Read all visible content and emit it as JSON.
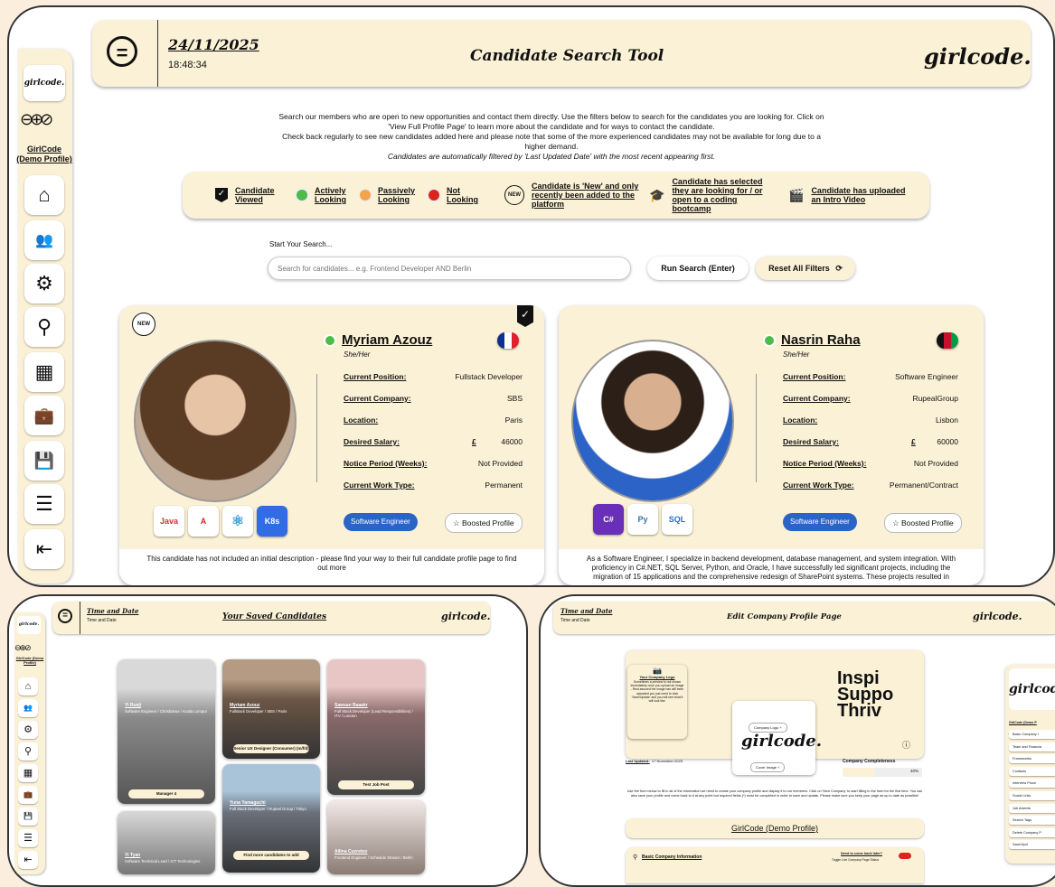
{
  "header": {
    "date": "24/11/2025",
    "time": "18:48:34",
    "title": "Candidate Search Tool",
    "brand": "girlcode."
  },
  "sidebar": {
    "logo": "girlcode.",
    "profile_label": "GirlCode (Demo Profile)",
    "items": [
      {
        "icon": "home-icon",
        "glyph": "⌂"
      },
      {
        "icon": "add-user-icon",
        "glyph": "👥"
      },
      {
        "icon": "gear-icon",
        "glyph": "⚙"
      },
      {
        "icon": "search-icon",
        "glyph": "⚲"
      },
      {
        "icon": "calendar-icon",
        "glyph": "▦"
      },
      {
        "icon": "briefcase-icon",
        "glyph": "💼"
      },
      {
        "icon": "save-icon",
        "glyph": "💾"
      },
      {
        "icon": "form-icon",
        "glyph": "☰"
      },
      {
        "icon": "logout-icon",
        "glyph": "⇤"
      }
    ]
  },
  "intro": {
    "line1": "Search our members who are open to new opportunities and contact them directly. Use the filters below to search for the candidates you are looking for. Click on 'View Full Profile Page' to learn more about the candidate and for ways to contact the candidate.",
    "line2": "Check back regularly to see new candidates added here and please note that some of the more experienced candidates may not be available for long due to a higher demand.",
    "note": "Candidates are automatically filtered by 'Last Updated Date' with the most recent appearing first."
  },
  "legend": {
    "viewed": "Candidate Viewed",
    "active": "Actively Looking",
    "passive": "Passively Looking",
    "not": "Not Looking",
    "new": "Candidate is 'New' and only recently been added to the platform",
    "bootcamp": "Candidate has selected they are looking for / or open to a coding bootcamp",
    "video": "Candidate has uploaded an Intro Video",
    "new_badge": "NEW",
    "colors": {
      "active": "#4cbb47",
      "passive": "#f3a34a",
      "not": "#d9261c"
    }
  },
  "search": {
    "label": "Start Your Search...",
    "placeholder": "Search for candidates... e.g. Frontend Developer AND Berlin",
    "run_label": "Run Search (Enter)",
    "reset_label": "Reset All Filters"
  },
  "field_labels": {
    "position": "Current Position:",
    "company": "Current Company:",
    "location": "Location:",
    "salary": "Desired Salary:",
    "notice": "Notice Period (Weeks):",
    "worktype": "Current Work Type:",
    "currency": "£",
    "boost": "Boosted Profile"
  },
  "candidates": [
    {
      "name": "Myriam Azouz",
      "pronouns": "She/Her",
      "position": "Fullstack Developer",
      "company": "SBS",
      "location": "Paris",
      "salary": "46000",
      "notice": "Not Provided",
      "worktype": "Permanent",
      "role_tag": "Software Engineer",
      "techs": [
        "Java",
        "A",
        "React",
        "K8s"
      ],
      "description": "This candidate has not included an initial description - please find your way to their full candidate profile page to find out more"
    },
    {
      "name": "Nasrin Raha",
      "pronouns": "She/Her",
      "position": "Software Engineer",
      "company": "RupealGroup",
      "location": "Lisbon",
      "salary": "60000",
      "notice": "Not Provided",
      "worktype": "Permanent/Contract",
      "role_tag": "Software Engineer",
      "techs": [
        "C#",
        "Py",
        "SQL"
      ],
      "description": "As a Software Engineer, I specialize in backend development, database management, and system integration. With proficiency in C#.NET, SQL Server, Python, and Oracle, I have successfully led significant projects, including the migration of 15 applications and the comprehensive redesign of SharePoint systems. These projects resulted in"
    }
  ],
  "saved_page": {
    "time_label": "Time and Date",
    "time_sub": "Time and Date",
    "title": "Your Saved Candidates",
    "brand": "girlcode.",
    "logo": "girlcode.",
    "profile": "GirlCode (Demo Profile)",
    "cards": [
      {
        "name": "Yi Rueji",
        "lines": "Software Engineer / Chrisbdvue / Kuala Lumpur",
        "tag": "Manager 4"
      },
      {
        "name": "Myriam Azouz",
        "lines": "Fullstack Developer / SBS / Paris",
        "tag": "Senior UX Designer (Consumer) (m/f/d)"
      },
      {
        "name": "Sawsan Baaakr",
        "lines": "Full Stack Developer (Lead Responsibilities) / ITV / London",
        "tag": "Test Job Post"
      },
      {
        "name": "Yuna Yamaguchi",
        "lines": "Full Stack Developer / Rupeal Group / Tokyo",
        "tag": "Find more candidates to add"
      },
      {
        "name": "Yi Tyan",
        "lines": "Software Technical Lead / ICT Technologies",
        "tag": ""
      },
      {
        "name": "Ailina Cuzretov",
        "lines": "Frontend Engineer / Schedule Stream / Berlin",
        "tag": ""
      }
    ]
  },
  "edit_page": {
    "time_label": "Time and Date",
    "time_sub": "Time and Date",
    "title": "Edit Company Profile Page",
    "brand": "girlcode.",
    "logo_title": "Your Company Logo",
    "logo_note": "Sometimes a preview is not shown immediately once you upload an image - Rest assured the image has still been uploaded you just need to click 'Save/Update' and you will see what it will look like.",
    "company_logo_btn": "Company Logo",
    "cover_image_btn": "Cover Image",
    "banner_text": "Inspi Suppo Thriv",
    "last_updated_label": "Last Updated:",
    "last_updated": "17 November 2025",
    "completeness_label": "Company Completeness",
    "completeness_pct": "40%",
    "completeness": 0.4,
    "info_text": "Use the form below to fill in all of the information we need to create your company profile and display it to our members. Click on 'New Company' to start filling in the form for the first time. You can also save your profile and come back to it at any point but required fields (*) must be completed in order to save and update. Please make sure you keep your page as up to date as possible!",
    "company_name": "GirlCode (Demo Profile)",
    "section_title": "Basic Company Information",
    "come_back": "Need to come back later?",
    "toggle_label": "Toggle Live Company Page Status",
    "side_logo": "girlcod",
    "side_profile": "GirlCode (Demo P",
    "nav": [
      "Basic Company I",
      "Team and Financia",
      "Frameworks",
      "Contacts",
      "Interview Proce",
      "Social Links",
      "Job Adverts",
      "Search Tags",
      "Delete Company P",
      "Save/Upd"
    ]
  }
}
